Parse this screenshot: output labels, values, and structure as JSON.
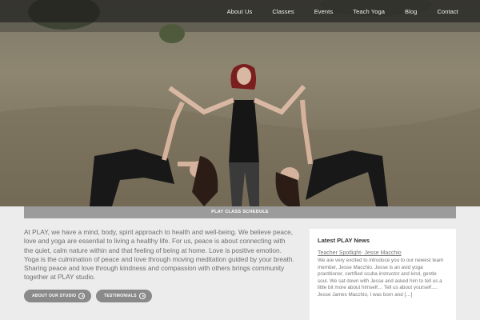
{
  "nav": {
    "items": [
      {
        "label": "About Us"
      },
      {
        "label": "Classes"
      },
      {
        "label": "Events"
      },
      {
        "label": "Teach Yoga"
      },
      {
        "label": "Blog"
      },
      {
        "label": "Contact"
      }
    ]
  },
  "hero": {
    "image": "three women in yoga poses in a dry grass field"
  },
  "schedule_bar": {
    "label": "PLAY CLASS SCHEDULE"
  },
  "intro": {
    "text": "At PLAY, we have a mind, body, spirit approach to health and well-being. We believe peace, love and yoga are essential to living a healthy life. For us, peace is about connecting with the quiet, calm nature within and that feeling of being at home. Love is positive emotion. Yoga is the culmination of peace and love through moving meditation guided by your breath. Sharing peace and love through kindness and compassion with others brings community together at PLAY studio."
  },
  "buttons": {
    "about": "ABOUT OUR STUDIO",
    "testimonials": "TESTIMONIALS"
  },
  "news": {
    "title": "Latest PLAY News",
    "post_title": "Teacher Spotlight- Jesse Macchio",
    "post_excerpt": "We are very excited to introduce you to our newest team member, Jesse Macchio. Jesse is an avid yoga practitioner, certified scuba instructor and kind, gentle soul. We sat down with Jesse and asked him to tell us a little bit more about himself… Tell us about yourself…. Jesse James Macchio, I was born and […]"
  },
  "colors": {
    "page_bg": "#ececec",
    "bar_gray": "#9b9b9b",
    "button_gray": "#8a8a8a",
    "text_gray": "#6e6e6e"
  }
}
